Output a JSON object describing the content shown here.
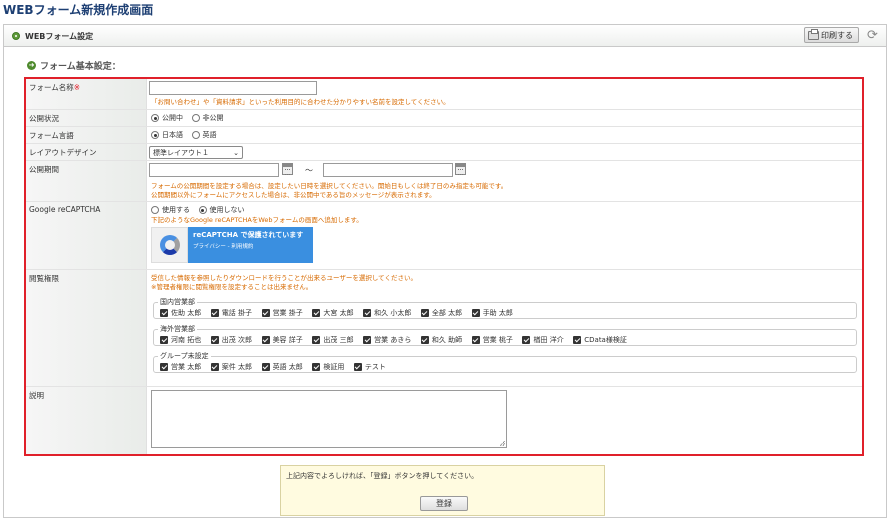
{
  "page": {
    "title": "WEBフォーム新規作成画面"
  },
  "header": {
    "title": "WEBフォーム設定",
    "print_label": "印刷する",
    "icons": [
      "green-dot-icon",
      "printer-icon",
      "refresh-icon"
    ]
  },
  "section": {
    "title": "フォーム基本設定："
  },
  "form": {
    "name": {
      "label": "フォーム名称",
      "required_mark": "※",
      "value": "",
      "note": "「お問い合わせ」や「資料請求」といった利用目的に合わせた分かりやすい名前を設定してください。"
    },
    "status": {
      "label": "公開状況",
      "options": [
        "公開中",
        "非公開"
      ],
      "selected": "公開中"
    },
    "language": {
      "label": "フォーム言語",
      "options": [
        "日本語",
        "英語"
      ],
      "selected": "日本語"
    },
    "layout": {
      "label": "レイアウトデザイン",
      "value": "標準レイアウト１"
    },
    "period": {
      "label": "公開期間",
      "separator": "～",
      "start": "",
      "end": "",
      "note1": "フォームの公開期間を設定する場合は、設定したい日時を選択してください。開始日もしくは終了日のみ指定も可能です。",
      "note2": "公開期間以外にフォームにアクセスした場合は、非公開中である旨のメッセージが表示されます。"
    },
    "recaptcha": {
      "label": "Google reCAPTCHA",
      "options": [
        "使用する",
        "使用しない"
      ],
      "selected": "使用しない",
      "note": "下記のようなGoogle reCAPTCHAをWebフォームの画面へ追加します。",
      "badge_title": "reCAPTCHA で保護されています",
      "badge_links": "プライバシー - 利用規約"
    },
    "access": {
      "label": "閲覧権限",
      "note1": "受信した情報を参照したりダウンロードを行うことが出来るユーザーを選択してください。",
      "note2": "※管理者権限に閲覧権限を設定することは出来ません。",
      "groups": [
        {
          "name": "国内営業部",
          "members": [
            "佐助 太郎",
            "電話 掛子",
            "営業 掛子",
            "大宮 太郎",
            "和久 小太郎",
            "全部 太郎",
            "手助 太郎"
          ]
        },
        {
          "name": "海外営業部",
          "members": [
            "河南 拓也",
            "出茂 次郎",
            "美容 詳子",
            "出茂 三郎",
            "営業 あきら",
            "和久 助師",
            "営業 桃子",
            "楢田 洋介",
            "CData様検証"
          ]
        },
        {
          "name": "グループ未設定",
          "members": [
            "営業 太郎",
            "案件 太郎",
            "英語 太郎",
            "検証用",
            "テスト"
          ]
        }
      ]
    },
    "description": {
      "label": "説明",
      "value": ""
    }
  },
  "confirm": {
    "message": "上記内容でよろしければ、「登録」ボタンを押してください。",
    "button": "登録"
  }
}
